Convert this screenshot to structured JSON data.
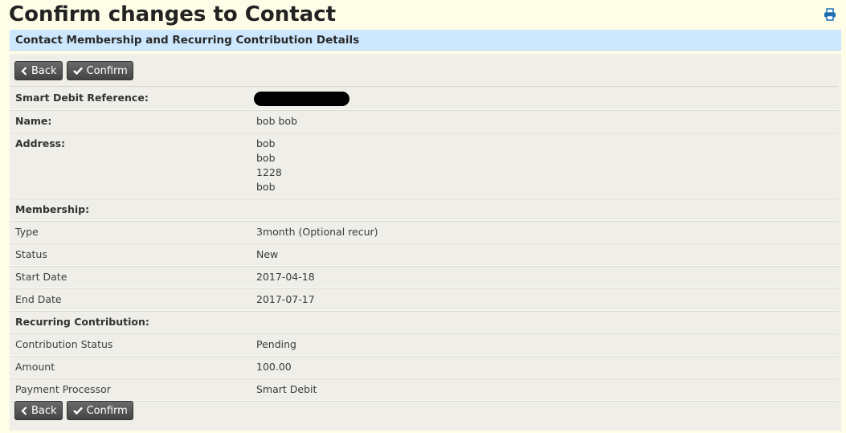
{
  "page": {
    "title": "Confirm changes to Contact",
    "print_icon": "print-icon"
  },
  "section": {
    "title": "Contact Membership and Recurring Contribution Details"
  },
  "buttons": {
    "back": "Back",
    "confirm": "Confirm"
  },
  "details": {
    "smart_debit_reference_label": "Smart Debit Reference:",
    "name_label": "Name:",
    "name_value": "bob bob",
    "address_label": "Address:",
    "address_lines": [
      "bob",
      "bob",
      "1228",
      "bob"
    ],
    "membership_label": "Membership:",
    "type_label": "Type",
    "type_value": "3month (Optional recur)",
    "status_label": "Status",
    "status_value": "New",
    "start_date_label": "Start Date",
    "start_date_value": "2017-04-18",
    "end_date_label": "End Date",
    "end_date_value": "2017-07-17",
    "recurring_label": "Recurring Contribution:",
    "contribution_status_label": "Contribution Status",
    "contribution_status_value": "Pending",
    "amount_label": "Amount",
    "amount_value": "100.00",
    "payment_processor_label": "Payment Processor",
    "payment_processor_value": "Smart Debit"
  }
}
